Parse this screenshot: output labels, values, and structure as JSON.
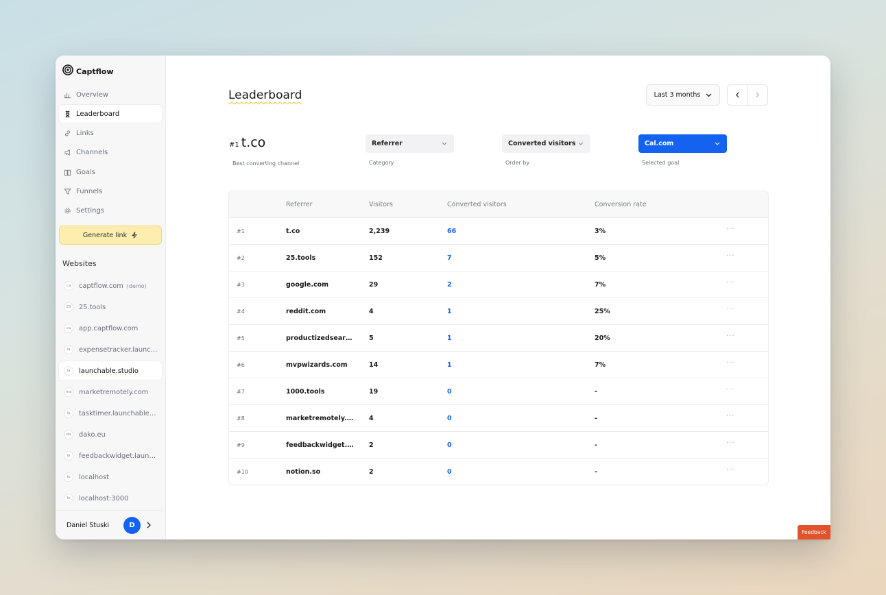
{
  "brand": {
    "name": "Captflow"
  },
  "nav": [
    {
      "label": "Overview",
      "icon": "bar-chart-icon",
      "active": false
    },
    {
      "label": "Leaderboard",
      "icon": "hourglass-icon",
      "active": true
    },
    {
      "label": "Links",
      "icon": "link-icon",
      "active": false
    },
    {
      "label": "Channels",
      "icon": "megaphone-icon",
      "active": false
    },
    {
      "label": "Goals",
      "icon": "book-icon",
      "active": false
    },
    {
      "label": "Funnels",
      "icon": "filter-icon",
      "active": false
    },
    {
      "label": "Settings",
      "icon": "gear-icon",
      "active": false
    }
  ],
  "generate_link": {
    "label": "Generate link",
    "icon": "lightning-icon"
  },
  "websites": {
    "title": "Websites",
    "items": [
      {
        "badge": "ca",
        "name": "captflow.com",
        "tag": "(demo)"
      },
      {
        "badge": "25",
        "name": "25.tools",
        "tag": ""
      },
      {
        "badge": "ca",
        "name": "app.captflow.com",
        "tag": ""
      },
      {
        "badge": "la",
        "name": "expensetracker.launch…",
        "tag": ""
      },
      {
        "badge": "la",
        "name": "launchable.studio",
        "tag": "",
        "active": true
      },
      {
        "badge": "ma",
        "name": "marketremotely.com",
        "tag": ""
      },
      {
        "badge": "la",
        "name": "tasktimer.launchable.st…",
        "tag": ""
      },
      {
        "badge": "da",
        "name": "dako.eu",
        "tag": ""
      },
      {
        "badge": "la",
        "name": "feedbackwidget.launch…",
        "tag": ""
      },
      {
        "badge": "lo",
        "name": "localhost",
        "tag": ""
      },
      {
        "badge": "lo",
        "name": "localhost:3000",
        "tag": ""
      }
    ]
  },
  "user": {
    "name": "Daniel Stuski",
    "initial": "D"
  },
  "page": {
    "title": "Leaderboard",
    "range_label": "Last 3 months"
  },
  "best": {
    "rank": "#1",
    "name": "t.co",
    "caption": "Best converting channel"
  },
  "filters": {
    "category": {
      "value": "Referrer",
      "caption": "Category"
    },
    "order_by": {
      "value": "Converted visitors",
      "caption": "Order by"
    },
    "goal": {
      "value": "Cal.com",
      "caption": "Selected goal"
    }
  },
  "table": {
    "headers": {
      "referrer": "Referrer",
      "visitors": "Visitors",
      "converted": "Converted visitors",
      "rate": "Conversion rate"
    },
    "more_label": "···",
    "rows": [
      {
        "rank": "#1",
        "referrer": "t.co",
        "visitors": "2,239",
        "converted": "66",
        "rate": "3%"
      },
      {
        "rank": "#2",
        "referrer": "25.tools",
        "visitors": "152",
        "converted": "7",
        "rate": "5%"
      },
      {
        "rank": "#3",
        "referrer": "google.com",
        "visitors": "29",
        "converted": "2",
        "rate": "7%"
      },
      {
        "rank": "#4",
        "referrer": "reddit.com",
        "visitors": "4",
        "converted": "1",
        "rate": "25%"
      },
      {
        "rank": "#5",
        "referrer": "productizedsearch.…",
        "visitors": "5",
        "converted": "1",
        "rate": "20%"
      },
      {
        "rank": "#6",
        "referrer": "mvpwizards.com",
        "visitors": "14",
        "converted": "1",
        "rate": "7%"
      },
      {
        "rank": "#7",
        "referrer": "1000.tools",
        "visitors": "19",
        "converted": "0",
        "rate": "-"
      },
      {
        "rank": "#8",
        "referrer": "marketremotely.com",
        "visitors": "4",
        "converted": "0",
        "rate": "-"
      },
      {
        "rank": "#9",
        "referrer": "feedbackwidget.lau…",
        "visitors": "2",
        "converted": "0",
        "rate": "-"
      },
      {
        "rank": "#10",
        "referrer": "notion.so",
        "visitors": "2",
        "converted": "0",
        "rate": "-"
      }
    ]
  },
  "feedback": {
    "label": "Feedback"
  },
  "colors": {
    "accent": "#1463f0",
    "highlight": "#fdeeb0",
    "feedback": "#e0532b"
  }
}
